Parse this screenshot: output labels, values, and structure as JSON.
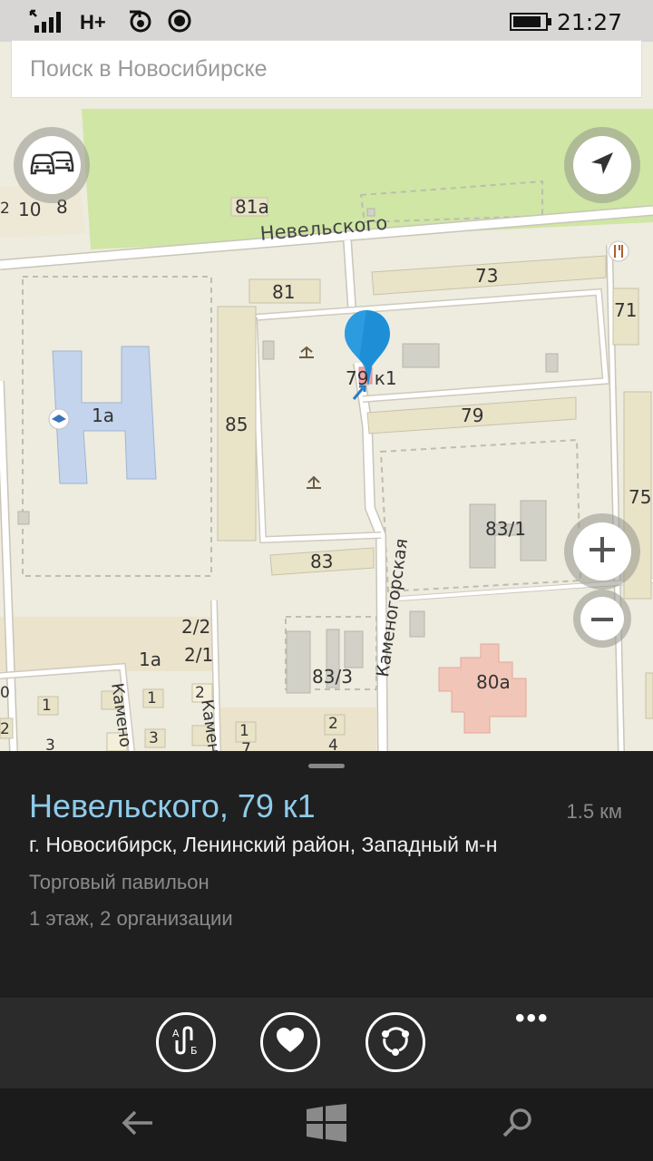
{
  "status_bar": {
    "network": "H+",
    "time": "21:27"
  },
  "search": {
    "placeholder": "Поиск в Новосибирске"
  },
  "map": {
    "street_labels": [
      "Невельского",
      "Каменогорская",
      "Камено",
      "Камен"
    ],
    "building_labels": [
      "10",
      "8",
      "81а",
      "73",
      "81",
      "71",
      "1а",
      "85",
      "79",
      "75",
      "83/1",
      "83",
      "2/2",
      "1а",
      "2/1",
      "83/3",
      "80а",
      "1",
      "1",
      "2",
      "1",
      "2",
      "3",
      "3",
      "4",
      "0",
      "2",
      "2",
      "3",
      "7",
      "1"
    ],
    "selected_label": "79 к1"
  },
  "place": {
    "title": "Невельского, 79 к1",
    "distance": "1.5 км",
    "address": "г. Новосибирск, Ленинский район, Западный м-н",
    "type": "Торговый павильон",
    "info": "1 этаж, 2 организации"
  },
  "actions": {
    "more": "•••"
  },
  "icons": {
    "traffic": "traffic-cars-icon",
    "locate": "locate-arrow-icon",
    "zoom_in": "plus-icon",
    "zoom_out": "minus-icon",
    "route": "route-ab-icon",
    "favorite": "heart-icon",
    "share": "share-icon",
    "back": "back-arrow-icon",
    "windows": "windows-logo-icon",
    "search": "search-icon"
  },
  "colors": {
    "accent": "#8fcbea",
    "pin": "#1e8fd6",
    "park": "#c7e29a"
  }
}
